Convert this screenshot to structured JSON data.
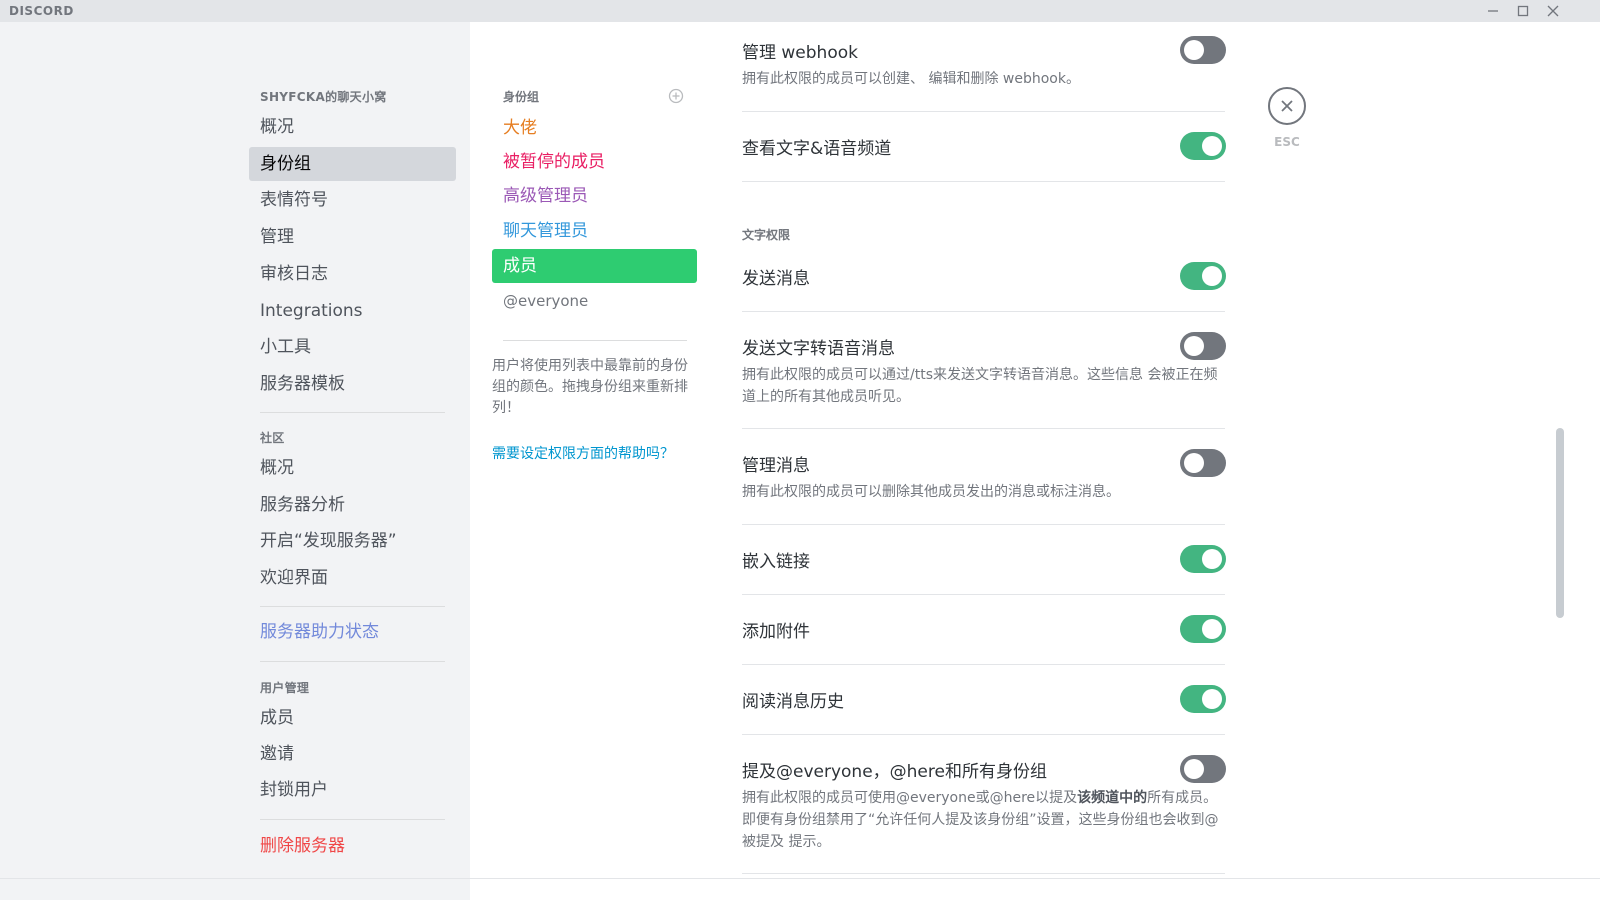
{
  "app": {
    "logo": "DISCORD"
  },
  "window_controls": {
    "minimize": "minimize-icon",
    "maximize": "maximize-icon",
    "close": "close-icon"
  },
  "sidebar": {
    "server_header": "SHYFCKA的聊天小窝",
    "server_items": [
      "概况",
      "身份组",
      "表情符号",
      "管理",
      "审核日志",
      "Integrations",
      "小工具",
      "服务器模板"
    ],
    "active_item": "身份组",
    "community_header": "社区",
    "community_items": [
      "概况",
      "服务器分析",
      "开启“发现服务器”",
      "欢迎界面"
    ],
    "boost_status": "服务器助力状态",
    "user_mgmt_header": "用户管理",
    "user_mgmt_items": [
      "成员",
      "邀请",
      "封锁用户"
    ],
    "delete_server": "删除服务器"
  },
  "roles": {
    "header": "身份组",
    "items": [
      {
        "name": "大佬",
        "color": "#e67e22"
      },
      {
        "name": "被暂停的成员",
        "color": "#e91e63"
      },
      {
        "name": "高级管理员",
        "color": "#9b59b6"
      },
      {
        "name": "聊天管理员",
        "color": "#3498db"
      },
      {
        "name": "成员",
        "color": "#2ecc71"
      },
      {
        "name": "@everyone",
        "color": "#72767d"
      }
    ],
    "selected": "成员",
    "hint": "用户将使用列表中最靠前的身份组的颜色。拖拽身份组来重新排列！",
    "help_link": "需要设定权限方面的帮助吗？"
  },
  "permissions": {
    "manage_webhooks": {
      "title": "管理 webhook",
      "desc": "拥有此权限的成员可以创建、 编辑和删除 webhook。",
      "enabled": false
    },
    "view_channels": {
      "title": "查看文字&语音频道",
      "enabled": true
    },
    "text_section": "文字权限",
    "send_messages": {
      "title": "发送消息",
      "enabled": true
    },
    "send_tts": {
      "title": "发送文字转语音消息",
      "desc": "拥有此权限的成员可以通过/tts来发送文字转语音消息。这些信息 会被正在频道上的所有其他成员听见。",
      "enabled": false
    },
    "manage_messages": {
      "title": "管理消息",
      "desc": "拥有此权限的成员可以删除其他成员发出的消息或标注消息。",
      "enabled": false
    },
    "embed_links": {
      "title": "嵌入链接",
      "enabled": true
    },
    "attach_files": {
      "title": "添加附件",
      "enabled": true
    },
    "read_history": {
      "title": "阅读消息历史",
      "enabled": true
    },
    "mention_everyone": {
      "title": "提及@everyone，@here和所有身份组",
      "desc_a": "拥有此权限的成员可使用@everyone或@here以提及",
      "desc_bold": "该频道中的",
      "desc_b": "所有成员。即便有身份组禁用了“允许任何人提及该身份组”设置，这些身份组也会收到@被提及 提示。",
      "enabled": false
    }
  },
  "close": {
    "label": "ESC"
  },
  "colors": {
    "accent": "#7289da",
    "toggle_on": "#43b581",
    "toggle_off": "#72767d",
    "danger": "#f04747"
  }
}
